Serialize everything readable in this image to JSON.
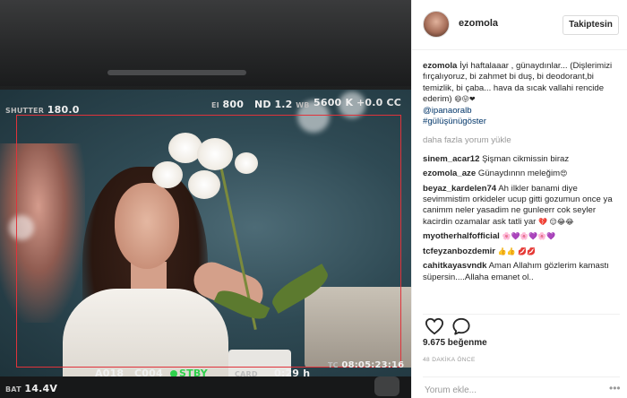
{
  "post": {
    "username": "ezomola",
    "follow_label": "Takiptesin",
    "caption_user": "ezomola",
    "caption_text": "İyi haftalaaar , günaydınlar... (Dişlerimizi fırçalıyoruz, bi zahmet bi duş, bi deodorant,bi temizlik, bi çaba... hava da sıcak vallahi rencide ederim)",
    "caption_emoji": "😄😛❤",
    "caption_mention": "@ipanaoralb",
    "caption_hashtag": "#gülüşünügöster",
    "load_more": "daha fazla yorum yükle",
    "comments": [
      {
        "user": "sinem_acar12",
        "text": "Şişman cikmissin biraz",
        "emoji": ""
      },
      {
        "user": "ezomola_aze",
        "text": "Günaydınnn meleğim",
        "emoji": "😍"
      },
      {
        "user": "beyaz_kardelen74",
        "text": "Ah ilkler banami diye sevimmistim orkideler ucup gitti gozumun once ya canimm neler yasadim ne gunleerr cok seyler kacirdin ozamalar ask tatli yar",
        "emoji": "💔 😌😂😂"
      },
      {
        "user": "myotherhalfofficial",
        "text": "",
        "emoji": "🌸💜🌸💜🌸💜"
      },
      {
        "user": "tcfeyzanbozdemir",
        "text": "",
        "emoji": "👍👍 💋💋"
      },
      {
        "user": "cahitkayasvndk",
        "text": "Aman Allahım gözlerim kamastı süpersin....Allaha emanet ol..",
        "emoji": ""
      }
    ],
    "likes": "9.675 beğenme",
    "time": "48 DAKİKA ÖNCE",
    "comment_placeholder": "Yorum ekle...",
    "more_icon": "ellipsis-icon"
  },
  "camera_hud": {
    "shutter_label": "SHUTTER",
    "shutter_value": "180.0",
    "ei_label": "EI",
    "ei_value": "800",
    "nd_label": "ND",
    "nd_value": "1.2",
    "wb_label": "WB",
    "wb_value": "5600 K",
    "cc_value": "+0.0 CC",
    "bat_label": "BAT",
    "bat_value": "14.4V",
    "reel": "A018",
    "clip": "C004",
    "stby": "STBY",
    "card_label": "CARD",
    "card_value": "0:29 h",
    "tc_label": "TC",
    "tc_value": "08:05:23:16"
  },
  "colors": {
    "link": "#003569",
    "recording_frame": "#e0333b",
    "stby_green": "#2fd14c"
  }
}
